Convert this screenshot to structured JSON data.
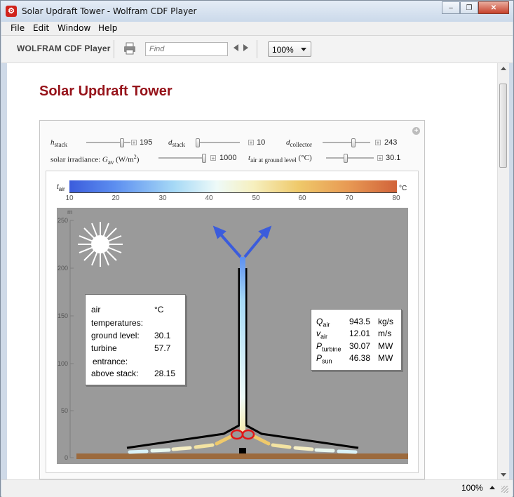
{
  "window": {
    "title": "Solar Updraft Tower - Wolfram CDF Player",
    "app_icon_glyph": "⚙",
    "controls": [
      "minimize-icon",
      "restore-icon",
      "close-icon"
    ],
    "minimize_glyph": "–",
    "restore_glyph": "❐",
    "close_glyph": "✕"
  },
  "menu": {
    "file": "File",
    "edit": "Edit",
    "window": "Window",
    "help": "Help"
  },
  "toolbar": {
    "brand": "WOLFRAM CDF Player",
    "find_placeholder": "Find",
    "zoom": "100%"
  },
  "status": {
    "zoom": "100%"
  },
  "page": {
    "title": "Solar Updraft Tower"
  },
  "controls": {
    "h_stack": {
      "sym": "h",
      "sub": "stack",
      "value": "195",
      "fraction": 0.84
    },
    "d_stack": {
      "sym": "d",
      "sub": "stack",
      "value": "10",
      "fraction": 0.0
    },
    "d_collector": {
      "sym": "d",
      "sub": "collector",
      "value": "243",
      "fraction": 0.66
    },
    "irradiance": {
      "label": "solar irradiance: ",
      "sym": "G",
      "sub": "av",
      "unit_pre": " (W/m",
      "unit_sup": "2",
      "unit_post": ")",
      "value": "1000",
      "fraction": 1.0
    },
    "t_air": {
      "sym": "t",
      "sub": "air at ground level",
      "unit": " (°C)",
      "value": "30.1",
      "fraction": 0.4
    },
    "expand_glyph": "+"
  },
  "legend": {
    "sym": "t",
    "sub": "air",
    "unit": "°C",
    "ticks": [
      "10",
      "20",
      "30",
      "40",
      "50",
      "60",
      "70",
      "80"
    ],
    "colors": [
      "#3b5cdc",
      "#a6d9f6",
      "#eefaf8",
      "#efc96a",
      "#d1633a"
    ]
  },
  "axis": {
    "unit": "m",
    "ticks": [
      "250",
      "200",
      "150",
      "100",
      "50",
      "0"
    ]
  },
  "temps": {
    "h_col1": "air",
    "h_col2": "°C",
    "h2": "temperatures:",
    "rows": [
      {
        "label": "ground level:",
        "value": "30.1"
      },
      {
        "label": "turbine",
        "value": "57.7"
      },
      {
        "label": "entrance:",
        "value": ""
      },
      {
        "label": "above stack:",
        "value": "28.15"
      }
    ]
  },
  "results": [
    {
      "sym": "Q",
      "sub": "air",
      "value": "943.5",
      "unit": "kg/s"
    },
    {
      "sym": "v",
      "sub": "air",
      "value": "12.01",
      "unit": "m/s"
    },
    {
      "sym": "P",
      "sub": "turbine",
      "value": "30.07",
      "unit": "MW"
    },
    {
      "sym": "P",
      "sub": "sun",
      "value": "46.38",
      "unit": "MW"
    }
  ]
}
